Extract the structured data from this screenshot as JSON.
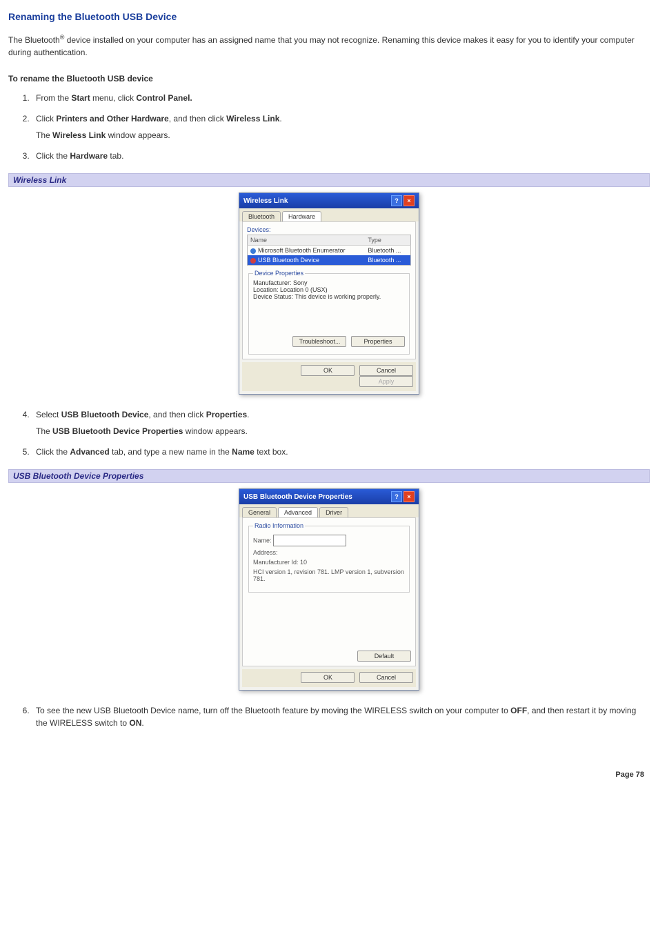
{
  "page": {
    "title": "Renaming the Bluetooth USB Device",
    "intro_before_sup": "The Bluetooth",
    "intro_sup": "®",
    "intro_after_sup": " device installed on your computer has an assigned name that you may not recognize. Renaming this device makes it easy for you to identify your computer during authentication.",
    "proc_heading": "To rename the Bluetooth USB device",
    "footer": "Page 78"
  },
  "steps": {
    "s1_a": "From the ",
    "s1_b": "Start",
    "s1_c": " menu, click ",
    "s1_d": "Control Panel.",
    "s2_a": "Click ",
    "s2_b": "Printers and Other Hardware",
    "s2_c": ", and then click ",
    "s2_d": "Wireless Link",
    "s2_e": ".",
    "s2_note_a": "The ",
    "s2_note_b": "Wireless Link",
    "s2_note_c": " window appears.",
    "s3_a": "Click the ",
    "s3_b": "Hardware",
    "s3_c": " tab.",
    "s4_a": "Select ",
    "s4_b": "USB Bluetooth Device",
    "s4_c": ", and then click ",
    "s4_d": "Properties",
    "s4_e": ".",
    "s4_note_a": "The ",
    "s4_note_b": "USB Bluetooth Device Properties",
    "s4_note_c": " window appears.",
    "s5_a": "Click the ",
    "s5_b": "Advanced",
    "s5_c": " tab, and type a new name in the ",
    "s5_d": "Name",
    "s5_e": " text box.",
    "s6_a": "To see the new USB Bluetooth Device name, turn off the Bluetooth feature by moving the WIRELESS switch on your computer to ",
    "s6_b": "OFF",
    "s6_c": ", and then restart it by moving the WIRELESS switch to ",
    "s6_d": "ON",
    "s6_e": "."
  },
  "caption1": "Wireless Link",
  "caption2": "USB Bluetooth Device Properties",
  "dialog1": {
    "title": "Wireless Link",
    "tab_bt": "Bluetooth",
    "tab_hw": "Hardware",
    "devices_label": "Devices:",
    "col_name": "Name",
    "col_type": "Type",
    "row1_name": "Microsoft Bluetooth Enumerator",
    "row1_type": "Bluetooth ...",
    "row2_name": "USB Bluetooth Device",
    "row2_type": "Bluetooth ...",
    "props_legend": "Device Properties",
    "manuf": "Manufacturer: Sony",
    "loc": "Location: Location 0 (USX)",
    "status": "Device Status: This device is working properly.",
    "btn_trouble": "Troubleshoot...",
    "btn_props": "Properties",
    "btn_ok": "OK",
    "btn_cancel": "Cancel",
    "btn_apply": "Apply"
  },
  "dialog2": {
    "title": "USB Bluetooth Device Properties",
    "tab_general": "General",
    "tab_adv": "Advanced",
    "tab_driver": "Driver",
    "radio_legend": "Radio Information",
    "name_label": "Name:",
    "addr_label": "Address:",
    "manu_label": "Manufacturer Id:     10",
    "hci": "HCI version 1, revision 781.  LMP version 1, subversion 781.",
    "btn_default": "Default",
    "btn_ok": "OK",
    "btn_cancel": "Cancel"
  }
}
